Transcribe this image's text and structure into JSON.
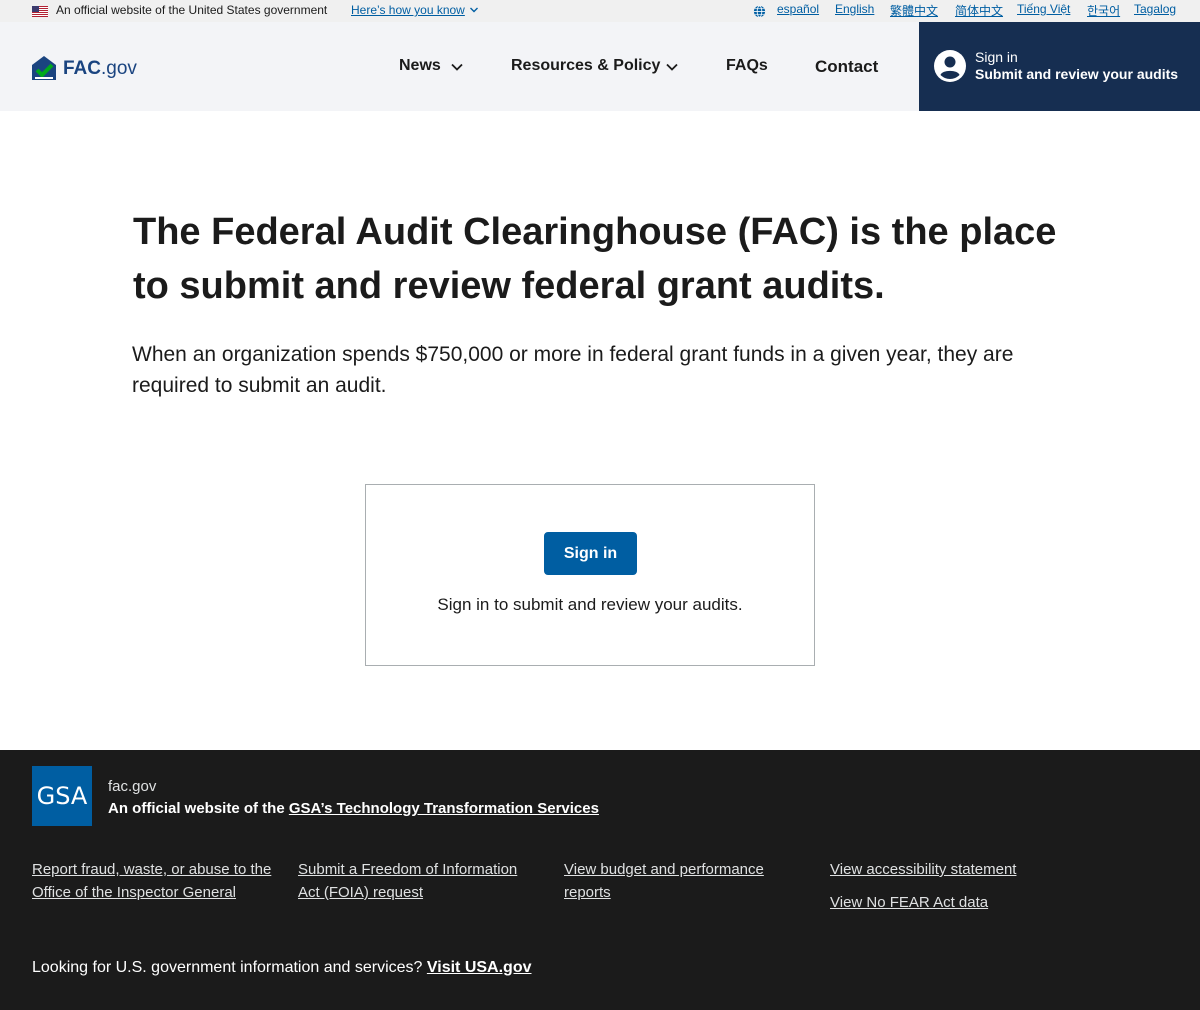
{
  "gov_banner": {
    "official_text": "An official website of the United States government",
    "how_link": "Here’s how you know",
    "languages": [
      "español",
      "English",
      "繁體中文",
      "简体中文",
      "Tiếng Việt",
      "한국어",
      "Tagalog"
    ]
  },
  "header": {
    "logo_bold": "FAC",
    "logo_suffix": ".gov",
    "nav": {
      "news": "News",
      "resources": "Resources & Policy",
      "faqs": "FAQs",
      "contact": "Contact"
    },
    "signin": {
      "line1": "Sign in",
      "line2": "Submit and review your audits"
    }
  },
  "hero": {
    "title": "The Federal Audit Clearinghouse (FAC) is the place to submit and review federal grant audits.",
    "subtitle": "When an organization spends $750,000 or more in federal grant funds in a given year, they are required to submit an audit."
  },
  "card": {
    "button": "Sign in",
    "text": "Sign in to submit and review your audits."
  },
  "footer": {
    "logo_text": "GSA",
    "site": "fac.gov",
    "official_prefix": "An official website of the ",
    "official_link": "GSA’s Technology Transformation Services",
    "links": {
      "fraud": "Report fraud, waste, or abuse to the Office of the Inspector General",
      "foia": "Submit a Freedom of Information Act (FOIA) request",
      "budget": "View budget and performance reports",
      "accessibility": "View accessibility statement",
      "nofear": "View No FEAR Act data"
    },
    "usa_prefix": "Looking for U.S. government information and services? ",
    "usa_link": "Visit USA.gov"
  },
  "colors": {
    "primary": "#005ea2",
    "navy": "#162e51",
    "footer_bg": "#1b1b1b",
    "banner_bg": "#f0f0f0"
  }
}
